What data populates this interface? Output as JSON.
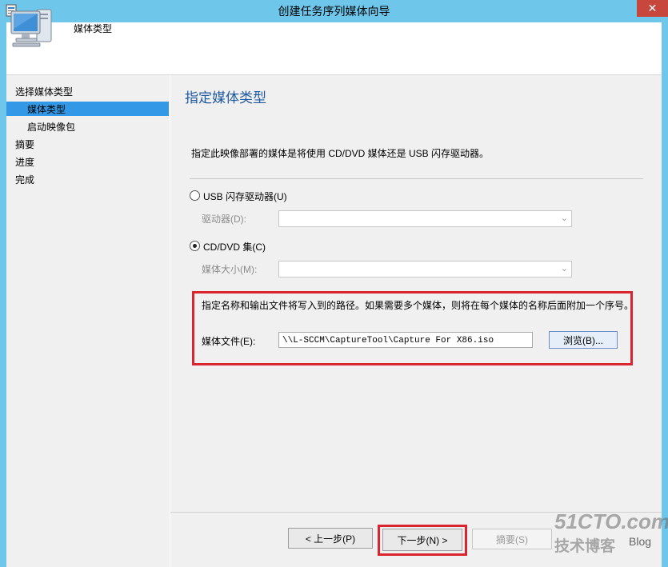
{
  "window": {
    "title": "创建任务序列媒体向导",
    "close_symbol": "✕"
  },
  "header": {
    "title": "媒体类型"
  },
  "nav": {
    "items": [
      {
        "label": "选择媒体类型"
      },
      {
        "label": "媒体类型"
      },
      {
        "label": "启动映像包"
      },
      {
        "label": "摘要"
      },
      {
        "label": "进度"
      },
      {
        "label": "完成"
      }
    ]
  },
  "page": {
    "heading": "指定媒体类型",
    "description": "指定此映像部署的媒体是将使用 CD/DVD 媒体还是 USB 闪存驱动器。",
    "usb_option": {
      "label": "USB 闪存驱动器(U)",
      "selected": false
    },
    "drive": {
      "label": "驱动器(D):",
      "value": ""
    },
    "cd_option": {
      "label": "CD/DVD 集(C)",
      "selected": true
    },
    "media_size": {
      "label": "媒体大小(M):",
      "value": ""
    },
    "output_note": "指定名称和输出文件将写入到的路径。如果需要多个媒体，则将在每个媒体的名称后面附加一个序号。",
    "media_file": {
      "label": "媒体文件(E):",
      "value": "\\\\L-SCCM\\CaptureTool\\Capture For X86.iso"
    },
    "browse_label": "浏览(B)..."
  },
  "footer": {
    "prev_label": "< 上一步(P)",
    "next_label": "下一步(N) >",
    "summary_label": "摘要(S)"
  },
  "watermark": {
    "line1": "51CTO.com",
    "line2": "技术博客",
    "line3": "Blog"
  },
  "colors": {
    "titlebar": "#6ec6ea",
    "selection": "#3399e6",
    "highlight_box": "#d9252f",
    "heading": "#1f5aa0"
  }
}
